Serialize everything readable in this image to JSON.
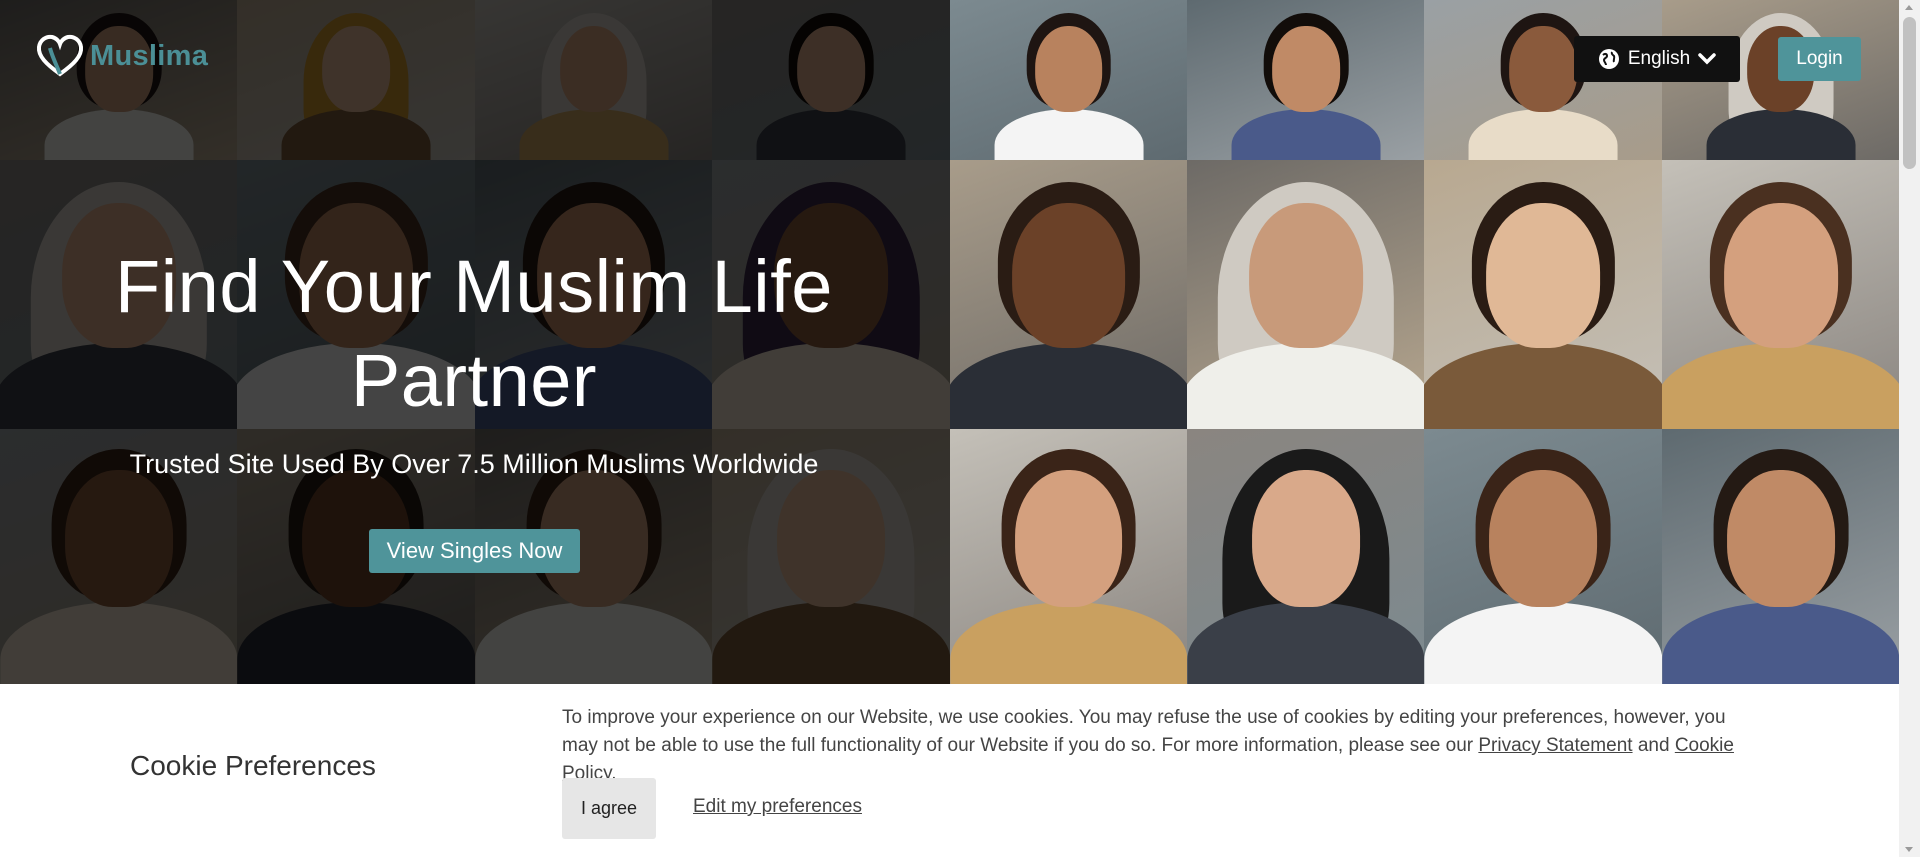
{
  "header": {
    "brand": "Muslima",
    "language_label": "English",
    "login_label": "Login"
  },
  "hero": {
    "headline_line1": "Find Your Muslim Life",
    "headline_line2": "Partner",
    "subheadline": "Trusted Site Used By Over 7.5 Million Muslims Worldwide",
    "cta_label": "View Singles Now"
  },
  "cookie_banner": {
    "title": "Cookie Preferences",
    "text_before": "To improve your experience on our Website, we use cookies. You may refuse the use of cookies by editing your preferences, however, you may not be able to use the full functionality of our Website if you do so. For more information, please see our ",
    "privacy_link": "Privacy Statement",
    "text_between": " and ",
    "cookie_link": "Cookie Policy",
    "text_after": ".",
    "agree_label": "I agree",
    "edit_label": "Edit my preferences"
  },
  "colors": {
    "brand_teal": "#4f949a",
    "logo_teal": "#4b8f96",
    "language_bg": "#111111",
    "agree_bg": "#e6e6e6"
  },
  "icons": [
    "heart-logo-icon",
    "globe-icon",
    "chevron-down-icon"
  ]
}
